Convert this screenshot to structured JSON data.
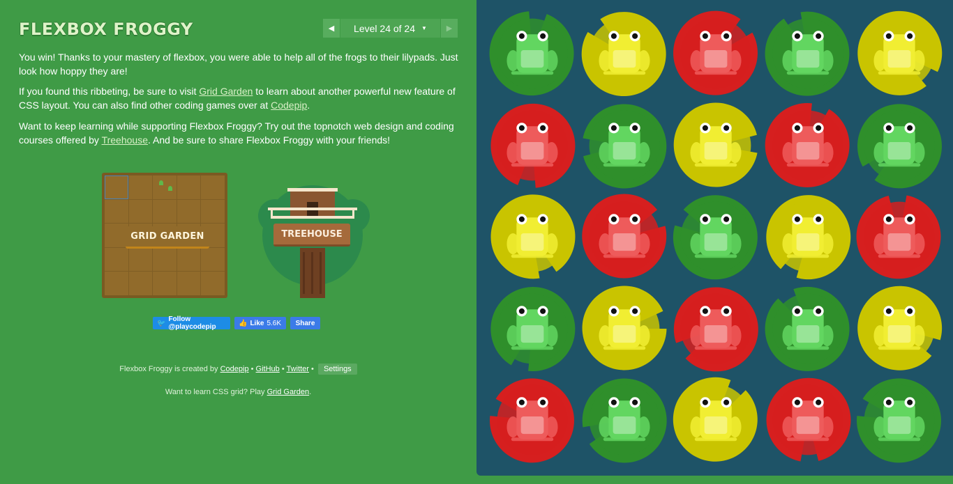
{
  "app": {
    "title": "FLEXBOX FROGGY",
    "level_label": "Level 24 of 24"
  },
  "intro": {
    "p1": "You win! Thanks to your mastery of flexbox, you were able to help all of the frogs to their lilypads. Just look how hoppy they are!",
    "p2_before": "If you found this ribbeting, be sure to visit ",
    "p2_link1": "Grid Garden",
    "p2_mid": " to learn about another powerful new feature of CSS layout. You can also find other coding games over at ",
    "p2_link2": "Codepip",
    "p2_after": ".",
    "p3_before": "Want to keep learning while supporting Flexbox Froggy? Try out the topnotch web design and coding courses offered by ",
    "p3_link": "Treehouse",
    "p3_after": ". And be sure to share Flexbox Froggy with your friends!"
  },
  "promos": {
    "grid_garden": "GRID GARDEN",
    "treehouse": "TREEHOUSE"
  },
  "social": {
    "twitter": "Follow @playcodepip",
    "like": "Like",
    "like_count": "5.6K",
    "share": "Share"
  },
  "footer": {
    "credit_before": "Flexbox Froggy is created by ",
    "codepip": "Codepip",
    "github": "GitHub",
    "twitter": "Twitter",
    "settings": "Settings",
    "learn_before": "Want to learn CSS grid? Play ",
    "learn_link": "Grid Garden",
    "learn_after": "."
  },
  "colors": {
    "background": "#3f9b46",
    "board": "#1e5367",
    "green_pad": "#2f8f2b",
    "green_frog": "#62d660",
    "yellow_pad": "#c9c400",
    "yellow_frog": "#f1ee32",
    "red_pad": "#d61f1f",
    "red_frog": "#ee5b5b"
  },
  "board": {
    "rows": [
      [
        "green",
        "yellow",
        "red",
        "green",
        "yellow"
      ],
      [
        "red",
        "green",
        "yellow",
        "red",
        "green"
      ],
      [
        "yellow",
        "red",
        "green",
        "yellow",
        "red"
      ],
      [
        "green",
        "yellow",
        "red",
        "green",
        "yellow"
      ],
      [
        "red",
        "green",
        "yellow",
        "red",
        "green"
      ]
    ]
  }
}
